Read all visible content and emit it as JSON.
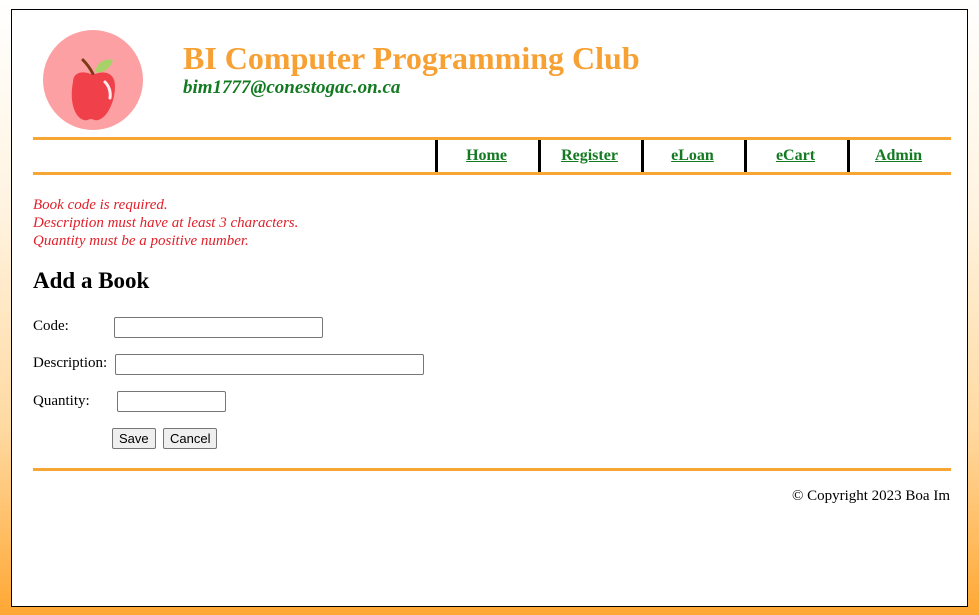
{
  "header": {
    "title": "BI Computer Programming Club",
    "email": "bim1777@conestogac.on.ca",
    "logo_icon": "apple-icon"
  },
  "nav": {
    "items": [
      {
        "label": "Home"
      },
      {
        "label": "Register"
      },
      {
        "label": "eLoan"
      },
      {
        "label": "eCart"
      },
      {
        "label": "Admin"
      }
    ]
  },
  "errors": [
    "Book code is required.",
    "Description must have at least 3 characters.",
    "Quantity must be a positive number."
  ],
  "form": {
    "title": "Add a Book",
    "code": {
      "label": "Code:",
      "value": ""
    },
    "description": {
      "label": "Description:",
      "value": ""
    },
    "quantity": {
      "label": "Quantity:",
      "value": ""
    },
    "save_label": "Save",
    "cancel_label": "Cancel"
  },
  "footer": {
    "copyright": "© Copyright 2023 Boa Im"
  },
  "colors": {
    "title": "#f7a033",
    "email": "#137a22",
    "nav_link": "#137a22",
    "rule": "#f7a633",
    "error": "#e0202a"
  }
}
